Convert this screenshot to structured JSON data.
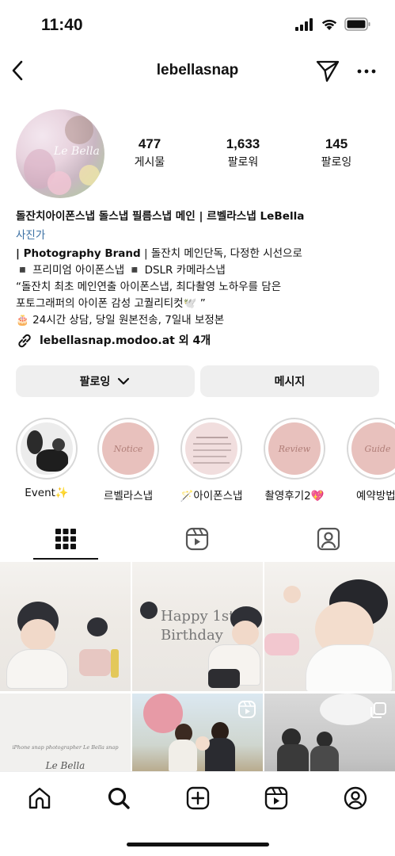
{
  "status": {
    "time": "11:40"
  },
  "header": {
    "username": "lebellasnap"
  },
  "profile": {
    "avatar_logo": "Le Bella",
    "stats": [
      {
        "value": "477",
        "label": "게시물"
      },
      {
        "value": "1,633",
        "label": "팔로워"
      },
      {
        "value": "145",
        "label": "팔로잉"
      }
    ],
    "name": "돌잔치아이폰스냅 돌스냅 필름스냅 메인 | 르벨라스냅 LeBella",
    "category": "사진가",
    "bio_line1_bold": "| Photography Brand",
    "bio_line1_rest": " | 돌잔치 메인단독, 다정한 시선으로",
    "bio_line2": "◾️ 프리미엄 아이폰스냅 ◾️ DSLR 카메라스냅",
    "bio_line3": "“돌잔치 최초 메인연출 아이폰스냅, 최다촬영 노하우를 담은",
    "bio_line4": "포토그래퍼의 아이폰 감성 고퀄리티컷🕊️ ”",
    "bio_line5": "🎂 24시간 상담, 당일 원본전송, 7일내 보정본",
    "link": "lebellasnap.modoo.at 외 4개"
  },
  "buttons": {
    "following": "팔로잉",
    "message": "메시지"
  },
  "highlights": [
    {
      "label": "Event✨",
      "cover_text": ""
    },
    {
      "label": "르벨라스냅",
      "cover_text": "Notice"
    },
    {
      "label": "🪄아이폰스냅",
      "cover_text": ""
    },
    {
      "label": "촬영후기2💖",
      "cover_text": "Review"
    },
    {
      "label": "예약방법",
      "cover_text": "Guide"
    }
  ],
  "grid": {
    "birthday_text_1": "Happy 1st",
    "birthday_text_2": "Birthday",
    "snap_caption": "iPhone snap photographer Le Bella snap",
    "snap_logo": "Le Bella"
  },
  "colors": {
    "link": "#3a6fa3",
    "button_bg": "#efefef",
    "highlight_pink": "#e8c1bd"
  }
}
